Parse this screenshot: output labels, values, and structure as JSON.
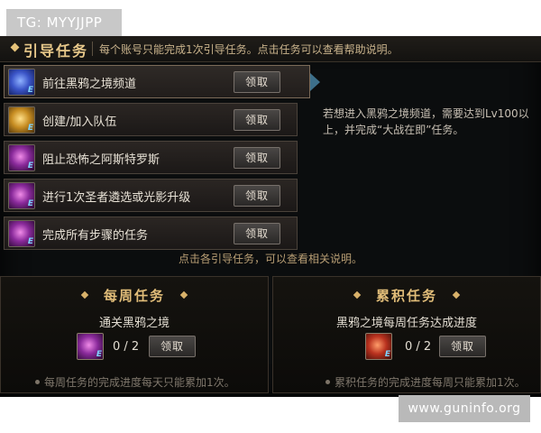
{
  "overlay_tl": "TG: MYYJJPP",
  "overlay_br": "www.guninfo.org",
  "guide": {
    "title": "引导任务",
    "hint": "每个账号只能完成1次引导任务。点击任务可以查看帮助说明。",
    "tasks": [
      {
        "label": "前往黑鸦之境频道",
        "button": "领取",
        "icon": "blue-cube-icon"
      },
      {
        "label": "创建/加入队伍",
        "button": "领取",
        "icon": "gold-medal-icon"
      },
      {
        "label": "阻止恐怖之阿斯特罗斯",
        "button": "领取",
        "icon": "purple-crystal-icon"
      },
      {
        "label": "进行1次圣者遴选或光影升级",
        "button": "领取",
        "icon": "purple-crystal-icon"
      },
      {
        "label": "完成所有步骤的任务",
        "button": "领取",
        "icon": "purple-crystal-icon"
      }
    ],
    "info": "若想进入黑鸦之境频道，需要达到Lv100以上，并完成“大战在即”任务。",
    "footer_hint": "点击各引导任务，可以查看相关说明。"
  },
  "weekly": {
    "title": "每周任务",
    "name": "通关黑鸦之境",
    "progress": "0 / 2",
    "button": "领取",
    "note": "每周任务的完成进度每天只能累加1次。",
    "icon": "purple-crystal-icon"
  },
  "cumulative": {
    "title": "累积任务",
    "name": "黑鸦之境每周任务达成进度",
    "progress": "0 / 2",
    "button": "领取",
    "note": "累积任务的完成进度每周只能累加1次。",
    "icon": "red-box-icon"
  },
  "colors": {
    "panel_bg": "#0b0d0e",
    "title_gold": "#e7c88a",
    "text_light": "#e8e2d6"
  }
}
